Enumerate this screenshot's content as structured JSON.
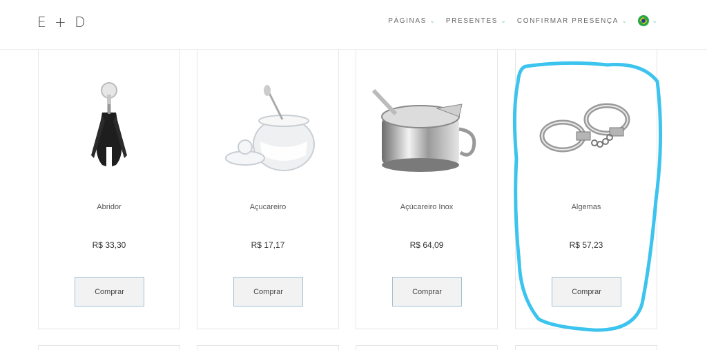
{
  "header": {
    "logo": "E + D",
    "nav": [
      {
        "label": "PÁGINAS"
      },
      {
        "label": "PRESENTES"
      },
      {
        "label": "CONFIRMAR PRESENÇA"
      }
    ],
    "language_flag": "brazil-flag-icon"
  },
  "products": [
    {
      "name": "Abridor",
      "price": "R$ 33,30",
      "button": "Comprar",
      "image": "corkscrew-image"
    },
    {
      "name": "Açucareiro",
      "price": "R$ 17,17",
      "button": "Comprar",
      "image": "sugar-bowl-image"
    },
    {
      "name": "Açúcareiro Inox",
      "price": "R$ 64,09",
      "button": "Comprar",
      "image": "stainless-sugar-bowl-image"
    },
    {
      "name": "Algemas",
      "price": "R$ 57,23",
      "button": "Comprar",
      "image": "handcuffs-image"
    }
  ],
  "colors": {
    "highlight": "#3cc4ef",
    "button_border": "#9fc0d6",
    "nav_chevron": "#8fd3c8"
  }
}
